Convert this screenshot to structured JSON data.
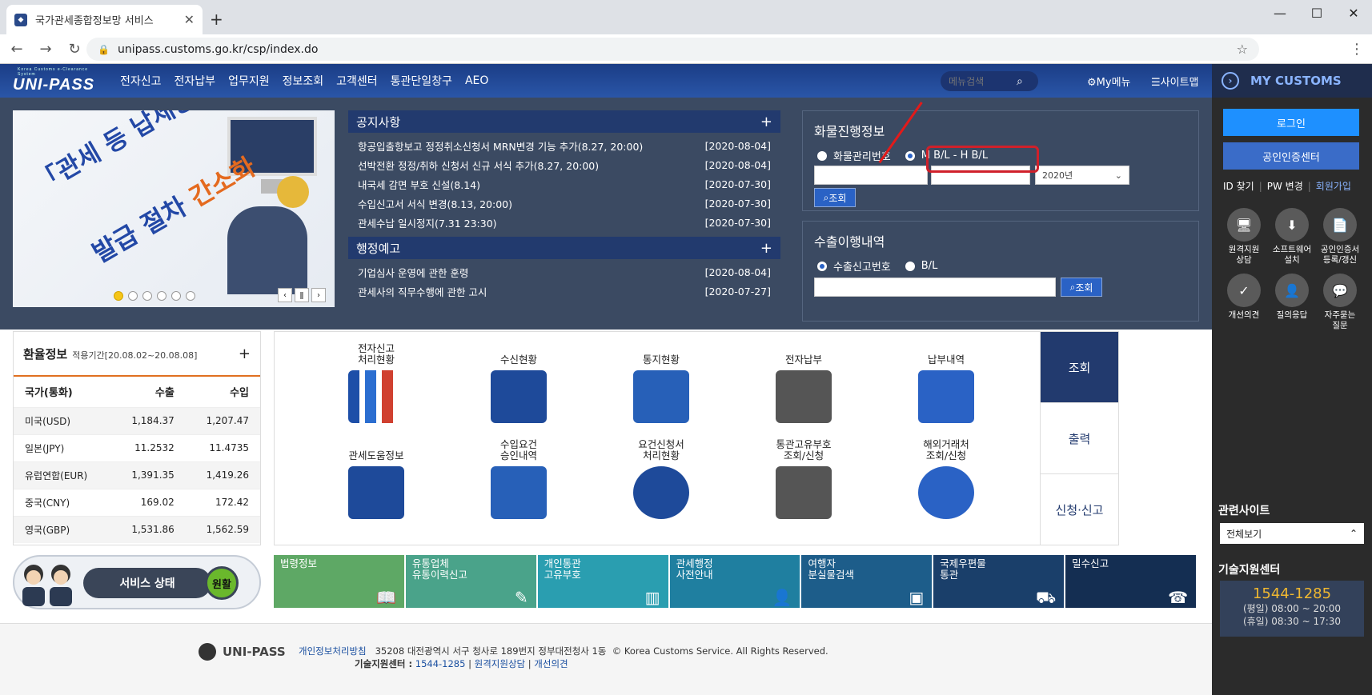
{
  "browser": {
    "tab_title": "국가관세종합정보망 서비스",
    "new_tab": "+",
    "window_controls": [
      "—",
      "☐",
      "✕"
    ],
    "url": "unipass.customs.go.kr/csp/index.do"
  },
  "gnb": {
    "logo": "UNI-PASS",
    "logo_sub": "Korea Customs e-Clearance System",
    "menu": [
      "전자신고",
      "전자납부",
      "업무지원",
      "정보조회",
      "고객센터",
      "통관단일창구",
      "AEO"
    ],
    "search_placeholder": "메뉴검색",
    "my_menu": "My메뉴",
    "sitemap": "사이트맵"
  },
  "notice": {
    "title": "공지사항",
    "items": [
      {
        "text": "항공입출항보고 정정취소신청서 MRN변경 기능 추가(8.27, 20:00)",
        "date": "[2020-08-04]"
      },
      {
        "text": "선박전환 정정/취하 신청서 신규 서식 추가(8.27, 20:00)",
        "date": "[2020-08-04]"
      },
      {
        "text": "내국세 감면 부호 신설(8.14)",
        "date": "[2020-07-30]"
      },
      {
        "text": "수입신고서 서식 변경(8.13, 20:00)",
        "date": "[2020-07-30]"
      },
      {
        "text": "관세수납 일시정지(7.31 23:30)",
        "date": "[2020-07-30]"
      }
    ]
  },
  "admin_notice": {
    "title": "행정예고",
    "items": [
      {
        "text": "기업심사 운영에 관한 훈령",
        "date": "[2020-08-04]"
      },
      {
        "text": "관세사의 직무수행에 관한 고시",
        "date": "[2020-07-27]"
      }
    ]
  },
  "banner": {
    "line1": "「관세 등 납세증명서」",
    "line2a": "발급 절차 ",
    "line2b": "간소화"
  },
  "cargo": {
    "title": "화물진행정보",
    "radio1": "화물관리번호",
    "radio2": "M B/L - H B/L",
    "year": "2020년",
    "search": "조회"
  },
  "export": {
    "title": "수출이행내역",
    "radio1": "수출신고번호",
    "radio2": "B/L",
    "search": "조회"
  },
  "rate": {
    "title": "환율정보",
    "period": "적용기간[20.08.02~20.08.08]",
    "headers": [
      "국가(통화)",
      "수출",
      "수입"
    ],
    "rows": [
      [
        "미국(USD)",
        "1,184.37",
        "1,207.47"
      ],
      [
        "일본(JPY)",
        "11.2532",
        "11.4735"
      ],
      [
        "유럽연합(EUR)",
        "1,391.35",
        "1,419.26"
      ],
      [
        "중국(CNY)",
        "169.02",
        "172.42"
      ],
      [
        "영국(GBP)",
        "1,531.86",
        "1,562.59"
      ]
    ]
  },
  "services": {
    "row1": [
      "전자신고\n처리현황",
      "수신현황",
      "통지현황",
      "전자납부",
      "납부내역"
    ],
    "row2": [
      "관세도움정보",
      "수입요건\n승인내역",
      "요건신청서\n처리현황",
      "통관고유부호\n조회/신청",
      "해외거래처\n조회/신청"
    ],
    "tabs": [
      "조회",
      "출력",
      "신청·신고"
    ]
  },
  "status": {
    "label": "서비스 상태",
    "value": "원활"
  },
  "links": [
    {
      "text": "법령정보",
      "color": "#5ea865"
    },
    {
      "text": "유통업체\n유통이력신고",
      "color": "#4aa38a"
    },
    {
      "text": "개인통관\n고유부호",
      "color": "#2a9eb0"
    },
    {
      "text": "관세행정\n사전안내",
      "color": "#1f7fa0"
    },
    {
      "text": "여행자\n분실물검색",
      "color": "#1d5d8a"
    },
    {
      "text": "국제우편물\n통관",
      "color": "#1a3f6a"
    },
    {
      "text": "밀수신고",
      "color": "#142e52"
    }
  ],
  "footer": {
    "logo": "UNI-PASS",
    "privacy": "개인정보처리방침",
    "address": "35208 대전광역시 서구 청사로 189번지 정부대전청사 1동",
    "copyright": "© Korea Customs Service. All Rights Reserved.",
    "tech_label": "기술지원센터 :",
    "tech_phone": "1544-1285",
    "remote": "원격지원상담",
    "feedback": "개선의견"
  },
  "sidebar": {
    "title": "MY CUSTOMS",
    "login": "로그인",
    "cert": "공인인증센터",
    "id_find": "ID 찾기",
    "pw_change": "PW 변경",
    "join": "회원가입",
    "icons": [
      "원격지원\n상담",
      "소프트웨어\n설치",
      "공인인증서\n등록/갱신",
      "개선의견",
      "질의응답",
      "자주묻는\n질문"
    ],
    "related": "관련사이트",
    "related_select": "전체보기",
    "tech_center": "기술지원센터",
    "tech_phone": "1544-1285",
    "weekday": "(평일) 08:00 ~ 20:00",
    "holiday": "(휴일) 08:30 ~ 17:30"
  }
}
